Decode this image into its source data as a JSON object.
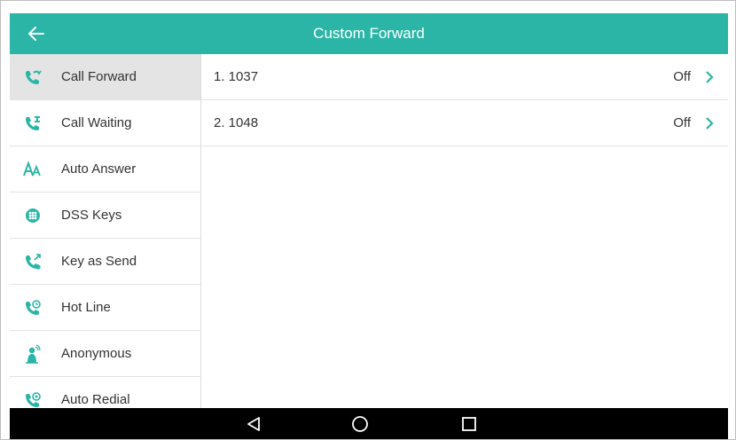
{
  "header": {
    "title": "Custom Forward",
    "back_icon": "arrow-left-icon"
  },
  "colors": {
    "accent": "#2bb5a6",
    "active_item_bg": "#e4e4e4",
    "navbar": "#000000"
  },
  "sidebar": {
    "items": [
      {
        "label": "Call Forward",
        "icon": "call-forward-icon",
        "active": true
      },
      {
        "label": "Call Waiting",
        "icon": "call-waiting-icon",
        "active": false
      },
      {
        "label": "Auto Answer",
        "icon": "auto-answer-icon",
        "active": false
      },
      {
        "label": "DSS Keys",
        "icon": "dss-keys-icon",
        "active": false
      },
      {
        "label": "Key as Send",
        "icon": "key-as-send-icon",
        "active": false
      },
      {
        "label": "Hot Line",
        "icon": "hot-line-icon",
        "active": false
      },
      {
        "label": "Anonymous",
        "icon": "anonymous-icon",
        "active": false
      },
      {
        "label": "Auto Redial",
        "icon": "auto-redial-icon",
        "active": false
      }
    ]
  },
  "content": {
    "rows": [
      {
        "label": "1. 1037",
        "value": "Off"
      },
      {
        "label": "2. 1048",
        "value": "Off"
      }
    ]
  },
  "navbar": {
    "buttons": [
      "back-triangle-icon",
      "home-circle-icon",
      "recents-square-icon"
    ]
  }
}
